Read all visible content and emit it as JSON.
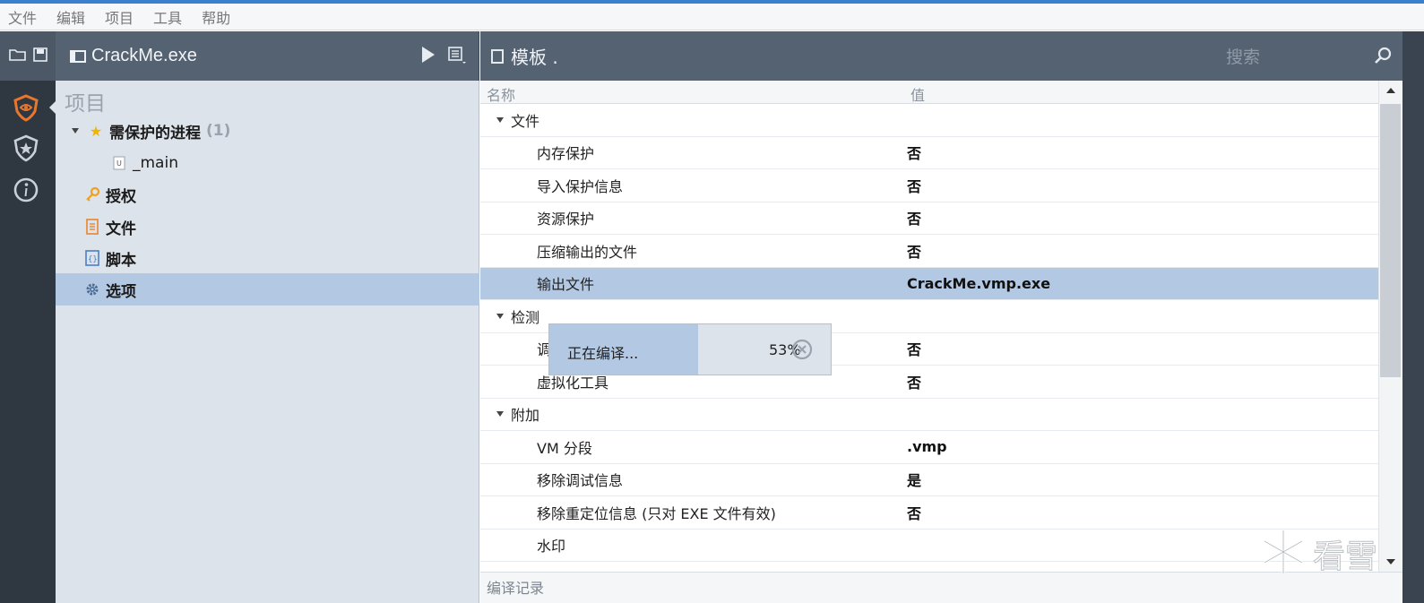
{
  "menubar": {
    "items": [
      "文件",
      "编辑",
      "项目",
      "工具",
      "帮助"
    ]
  },
  "rail": {
    "buttons": [
      "shield-project-icon",
      "shield-star-icon",
      "info-icon"
    ]
  },
  "project_header": {
    "title": "CrackMe.exe"
  },
  "tree": {
    "heading": "项目",
    "items": [
      {
        "label": "需保护的进程",
        "count": "(1)",
        "icon": "star-icon"
      },
      {
        "label": "_main",
        "icon": "function-icon"
      },
      {
        "label": "授权",
        "icon": "key-icon"
      },
      {
        "label": "文件",
        "icon": "file-list-icon"
      },
      {
        "label": "脚本",
        "icon": "script-icon"
      },
      {
        "label": "选项",
        "icon": "gear-icon"
      }
    ]
  },
  "template_header": {
    "label": "模板 .",
    "search_placeholder": "搜索"
  },
  "grid": {
    "col_name": "名称",
    "col_value": "值",
    "rows": [
      {
        "type": "section",
        "name": "文件",
        "value": ""
      },
      {
        "type": "item",
        "name": "内存保护",
        "value": "否"
      },
      {
        "type": "item",
        "name": "导入保护信息",
        "value": "否"
      },
      {
        "type": "item",
        "name": "资源保护",
        "value": "否"
      },
      {
        "type": "item",
        "name": "压缩输出的文件",
        "value": "否"
      },
      {
        "type": "item",
        "name": "输出文件",
        "value": "CrackMe.vmp.exe"
      },
      {
        "type": "section",
        "name": "检测",
        "value": ""
      },
      {
        "type": "item",
        "name": "调",
        "value": "否"
      },
      {
        "type": "item",
        "name": "虚拟化工具",
        "value": "否"
      },
      {
        "type": "section",
        "name": "附加",
        "value": ""
      },
      {
        "type": "item",
        "name": "VM 分段",
        "value": ".vmp"
      },
      {
        "type": "item",
        "name": "移除调试信息",
        "value": "是"
      },
      {
        "type": "item",
        "name": "移除重定位信息 (只对 EXE 文件有效)",
        "value": "否"
      },
      {
        "type": "item",
        "name": "水印",
        "value": ""
      }
    ]
  },
  "log": {
    "title": "编译记录"
  },
  "progress": {
    "text": "正在编译...",
    "percent_label": "53%",
    "percent": 0.53
  },
  "watermark": {
    "text": "看雪"
  },
  "colors": {
    "accent_orange": "#e8772e",
    "selection": "#b3c8e2",
    "header_bg": "#556272",
    "rail_bg": "#2f3741"
  }
}
